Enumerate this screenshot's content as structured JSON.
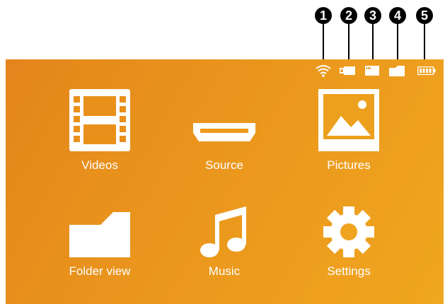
{
  "callouts": [
    "1",
    "2",
    "3",
    "4",
    "5"
  ],
  "status_icons": [
    "wifi-icon",
    "usb-stick-icon",
    "sd-card-icon",
    "internal-memory-icon",
    "battery-icon"
  ],
  "menu": {
    "items": [
      {
        "label": "Videos",
        "icon": "film-icon"
      },
      {
        "label": "Source",
        "icon": "hdmi-icon"
      },
      {
        "label": "Pictures",
        "icon": "picture-icon"
      },
      {
        "label": "Folder view",
        "icon": "folder-icon"
      },
      {
        "label": "Music",
        "icon": "music-note-icon"
      },
      {
        "label": "Settings",
        "icon": "gear-icon"
      }
    ]
  },
  "colors": {
    "background_start": "#e4851b",
    "background_end": "#f0a61e",
    "icon": "#ffffff",
    "callout": "#000000"
  }
}
